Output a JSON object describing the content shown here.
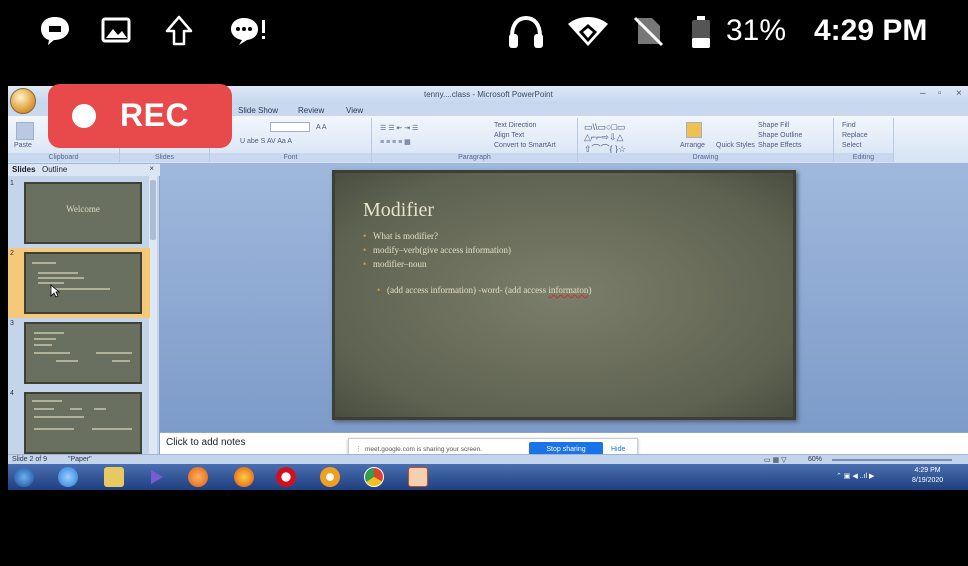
{
  "status_bar": {
    "battery_percent": "31%",
    "clock": "4:29 PM",
    "icons": [
      "chat-bubble-icon",
      "image-icon",
      "upload-arrow-icon",
      "alert-bubble-icon",
      "headset-icon",
      "wifi-icon",
      "no-sim-icon",
      "battery-icon"
    ]
  },
  "recording": {
    "label": "REC",
    "color": "#e8494b"
  },
  "powerpoint": {
    "window_title": "tenny....class - Microsoft PowerPoint",
    "ribbon_tabs": [
      "Slide Show",
      "Review",
      "View"
    ],
    "ribbon": {
      "paste": "Paste",
      "text_direction": "Text Direction",
      "align_text": "Align Text",
      "convert_smartart": "Convert to SmartArt",
      "arrange": "Arrange",
      "quick_styles": "Quick Styles",
      "shape_fill": "Shape Fill",
      "shape_outline": "Shape Outline",
      "shape_effects": "Shape Effects",
      "find": "Find",
      "replace": "Replace",
      "select": "Select",
      "groups": {
        "clipboard": "Clipboard",
        "slides": "Slides",
        "font": "Font",
        "paragraph": "Paragraph",
        "drawing": "Drawing",
        "editing": "Editing"
      }
    },
    "panel_tabs": {
      "slides": "Slides",
      "outline": "Outline"
    },
    "thumbnails": [
      {
        "number": "1",
        "title": "Welcome"
      },
      {
        "number": "2",
        "title": ""
      },
      {
        "number": "3",
        "title": ""
      },
      {
        "number": "4",
        "title": ""
      }
    ],
    "slide": {
      "title": "Modifier",
      "bullets": [
        "What is modifier?",
        "modify–verb(give access information)",
        "modifier–noun"
      ],
      "bullet4_prefix": "(add access information)  -word-  (add access ",
      "bullet4_misspelled": "informaton",
      "bullet4_suffix": ")"
    },
    "notes_placeholder": "Click to add notes",
    "status_left": "Slide 2 of 9",
    "theme_name": "\"Paper\"",
    "zoom": "60%"
  },
  "share_notice": {
    "message": "meet.google.com is sharing your screen.",
    "stop_label": "Stop sharing",
    "hide_label": "Hide"
  },
  "taskbar": {
    "time": "4:29 PM",
    "date": "8/19/2020",
    "apps": [
      "windows-start-icon",
      "ie-icon",
      "explorer-icon",
      "media-player-icon",
      "media-center-icon",
      "firefox-icon",
      "opera-icon",
      "chrome-canary-icon",
      "chrome-icon",
      "powerpoint-icon"
    ]
  }
}
